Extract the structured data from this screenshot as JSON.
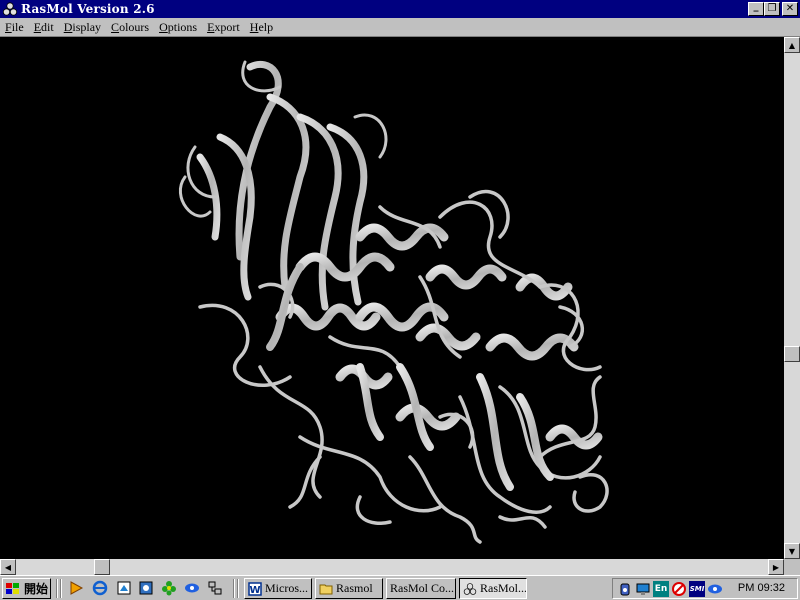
{
  "window": {
    "title": "RasMol Version 2.6"
  },
  "menu": [
    "File",
    "Edit",
    "Display",
    "Colours",
    "Options",
    "Export",
    "Help"
  ],
  "window_buttons": {
    "minimize": "_",
    "restore": "❐",
    "close": "✕"
  },
  "viewer": {
    "background": "#000000",
    "ribbon_color": "#c8c8c8",
    "content": "protein ribbon rendering"
  },
  "taskbar": {
    "start_label": "開始",
    "quick_launch": [
      "media-player-icon",
      "ie-icon",
      "desktop-icon",
      "channels-icon",
      "flower-icon",
      "eye-icon",
      "network-icon"
    ],
    "tasks": [
      {
        "label": "Micros...",
        "icon": "word-icon",
        "active": false
      },
      {
        "label": "Rasmol",
        "icon": "folder-icon",
        "active": false
      },
      {
        "label": "RasMol Co...",
        "icon": "",
        "active": false
      },
      {
        "label": "RasMol...",
        "icon": "rasmol-icon",
        "active": true
      }
    ],
    "clock": "PM 09:32",
    "tray_language": "En",
    "tray_badge": "SMI"
  },
  "colors": {
    "titlebar": "#000080",
    "chrome": "#c0c0c0"
  }
}
